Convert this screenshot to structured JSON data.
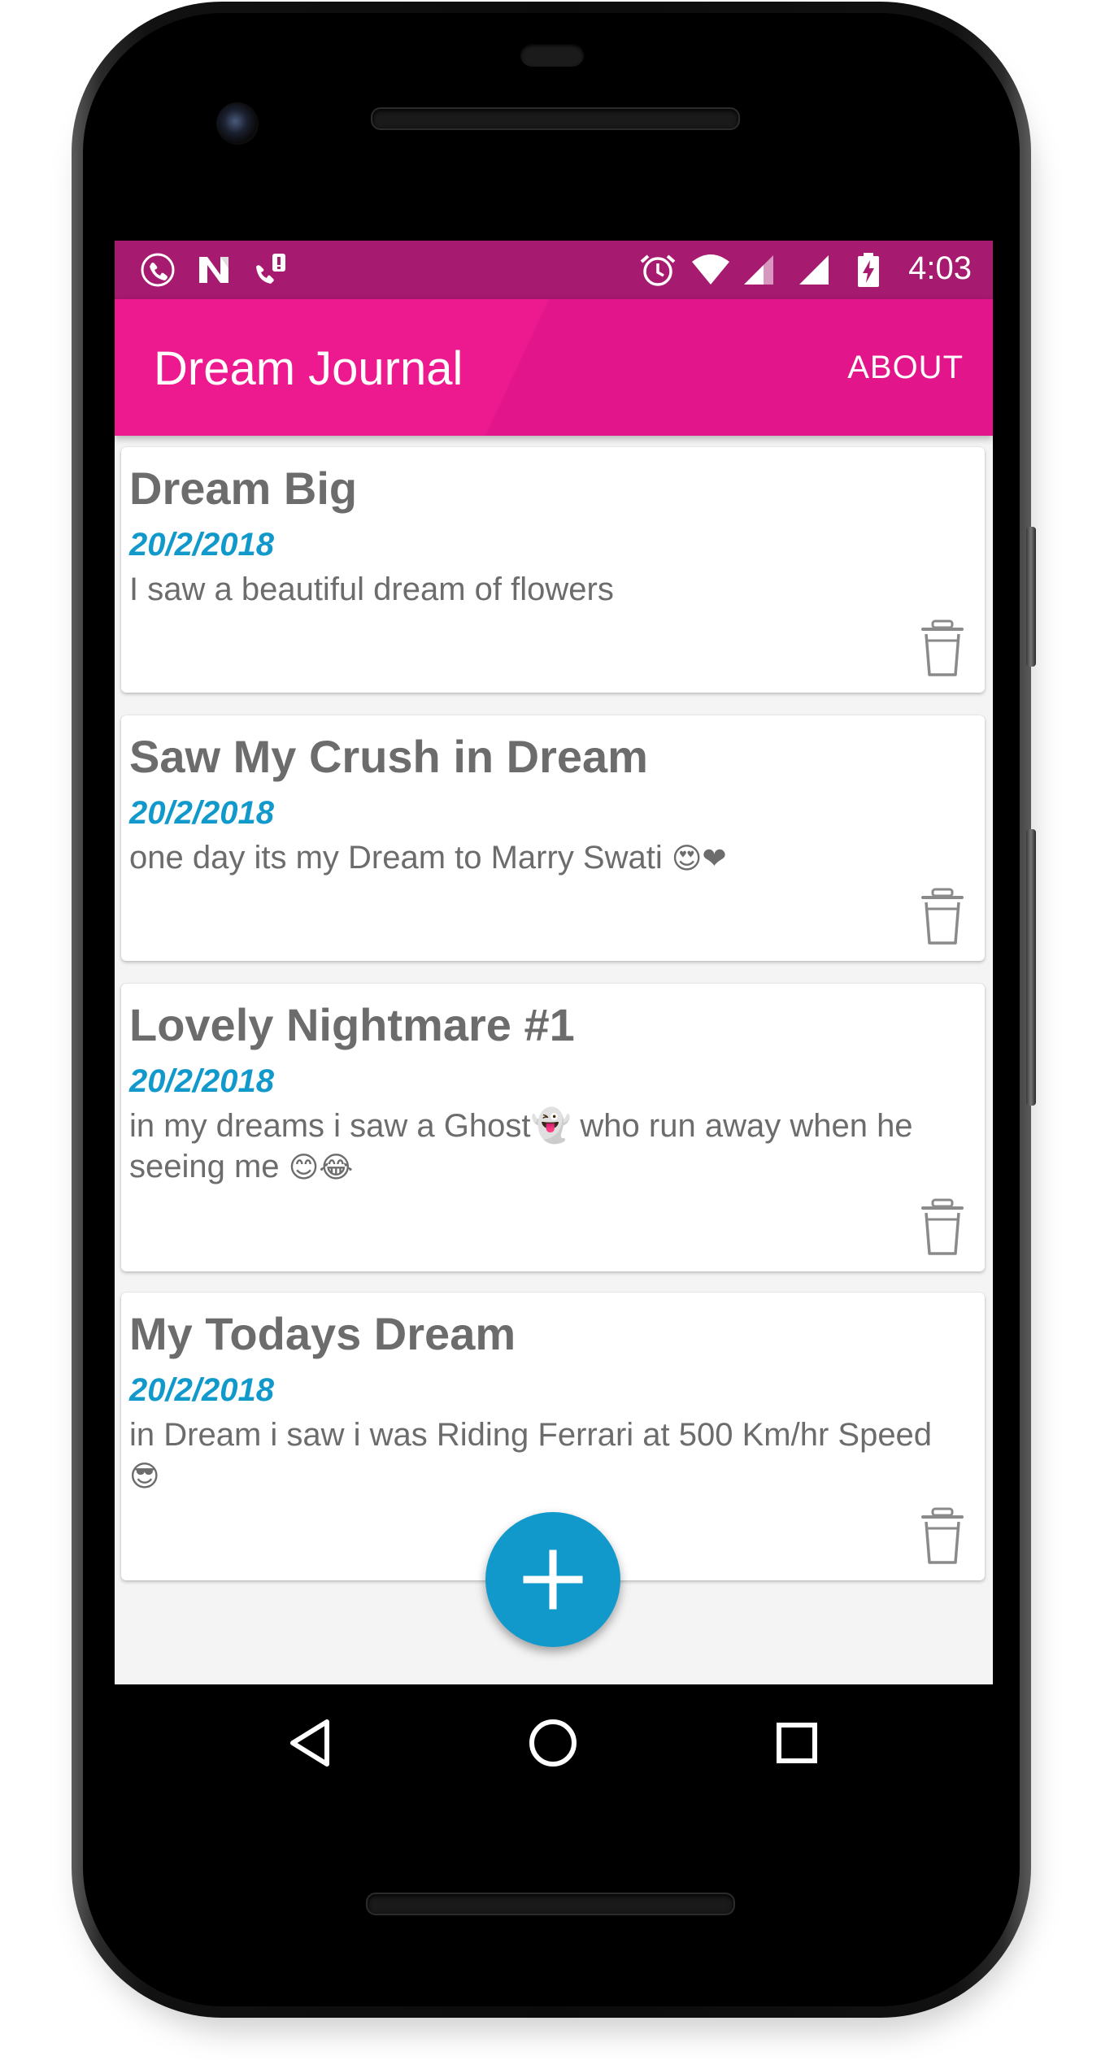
{
  "status_bar": {
    "time": "4:03",
    "left_icons": [
      "call-icon",
      "n-logo-icon",
      "missed-call-icon"
    ],
    "right_icons": [
      "alarm-icon",
      "wifi-icon",
      "signal-icon",
      "signal-full-icon",
      "battery-charging-icon"
    ]
  },
  "app_bar": {
    "title": "Dream Journal",
    "action_label": "ABOUT",
    "color": "#ec1a8e"
  },
  "entries": [
    {
      "title": "Dream Big",
      "date": "20/2/2018",
      "body": "I saw a beautiful dream of flowers",
      "emojis": ""
    },
    {
      "title": "Saw My Crush in Dream",
      "date": "20/2/2018",
      "body": "one day its my Dream to Marry Swati",
      "emojis": "😍❤"
    },
    {
      "title": "Lovely Nightmare #1",
      "date": "20/2/2018",
      "body": "in my dreams i saw a Ghost👻 who run away when he seeing me",
      "emojis": "😊😂"
    },
    {
      "title": "My Todays Dream",
      "date": "20/2/2018",
      "body": "in Dream i saw i was Riding Ferrari at 500 Km/hr Speed",
      "emojis": "😎"
    }
  ],
  "fab": {
    "icon": "plus-icon",
    "color": "#1199cc"
  },
  "nav_bar": {
    "icons": [
      "back-icon",
      "home-icon",
      "recents-icon"
    ]
  }
}
